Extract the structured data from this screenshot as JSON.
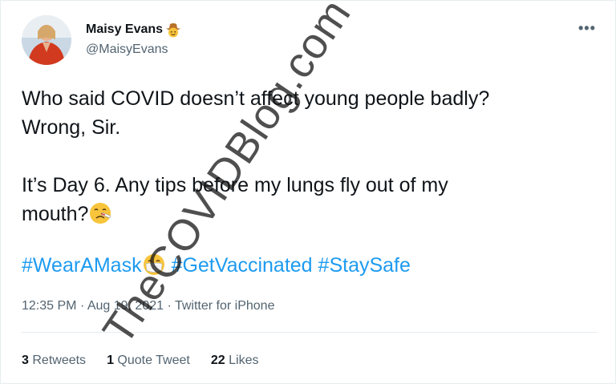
{
  "author": {
    "display_name": "Maisy Evans",
    "handle": "@MaisyEvans",
    "name_emoji": "cowboy-face-icon"
  },
  "more_label": "•••",
  "tweet": {
    "lines": [
      "Who said COVID doesn’t affect young people badly?",
      "Wrong, Sir.",
      "It’s Day 6. Any tips before my lungs fly out of my",
      "mouth?"
    ],
    "hashtags": [
      "#WearAMask",
      "#GetVaccinated",
      "#StaySafe"
    ]
  },
  "meta": {
    "time": "12:35 PM",
    "separator": "·",
    "date": "Aug 19, 2021",
    "source": "Twitter for iPhone"
  },
  "stats": {
    "retweets_count": "3",
    "retweets_label": "Retweets",
    "quotes_count": "1",
    "quotes_label": "Quote Tweet",
    "likes_count": "22",
    "likes_label": "Likes"
  },
  "watermark": "TheCOVIDBlog.com",
  "colors": {
    "link": "#1d9bf0",
    "secondary_text": "#536471",
    "primary_text": "#0f1419"
  }
}
